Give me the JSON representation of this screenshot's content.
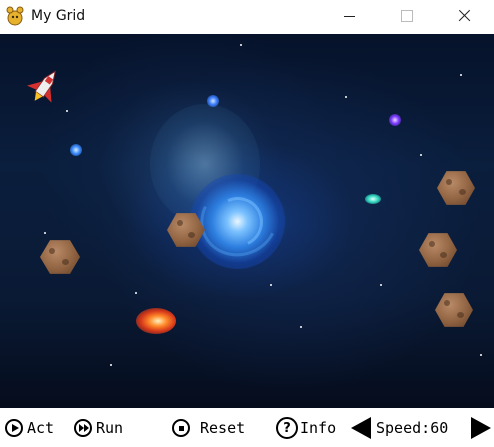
{
  "window": {
    "title": "My Grid",
    "app_icon": "greenfoot-icon",
    "controls": [
      "minimize-icon",
      "maximize-icon",
      "close-icon"
    ]
  },
  "world": {
    "background": "space-nebula-vortex",
    "actors": [
      {
        "kind": "rocket",
        "icon": "rocket-icon"
      },
      {
        "kind": "asteroid",
        "icon": "asteroid-icon",
        "count": 5
      },
      {
        "kind": "explosion",
        "icon": "explosion-icon"
      }
    ]
  },
  "controls": {
    "act_label": "Act",
    "run_label": "Run",
    "reset_label": "Reset",
    "info_label": "Info",
    "speed_label": "Speed:",
    "speed_value": "60",
    "info_icon_glyph": "?"
  }
}
